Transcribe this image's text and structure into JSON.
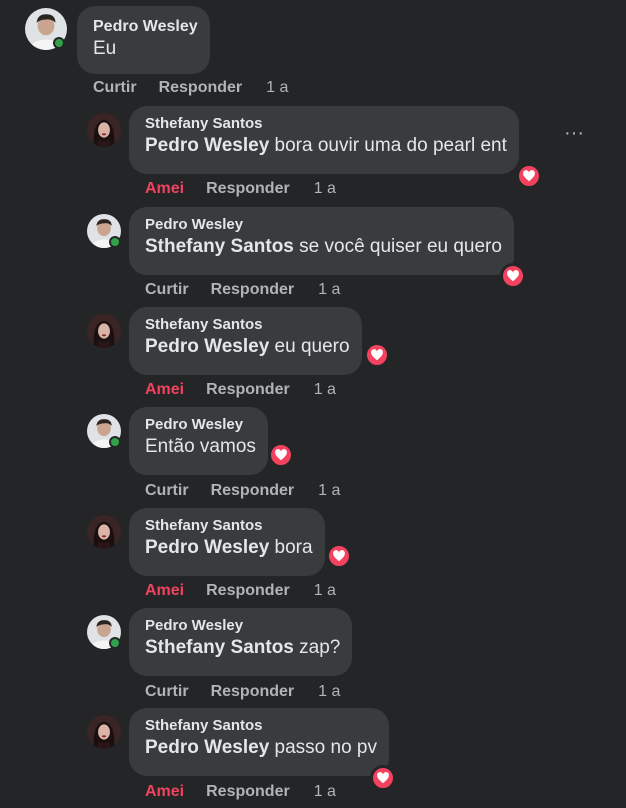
{
  "comment": {
    "author": "Pedro Wesley",
    "text": "Eu",
    "actions": {
      "like": "Curtir",
      "reply": "Responder",
      "time": "1 a"
    }
  },
  "replies": [
    {
      "author": "Sthefany Santos",
      "mention": "Pedro Wesley",
      "text": " bora ouvir uma do pearl ent",
      "reaction": "love",
      "like_label": "Amei",
      "reply_label": "Responder",
      "time": "1 a"
    },
    {
      "author": "Pedro Wesley",
      "mention": "Sthefany Santos",
      "text": " se você quiser eu quero",
      "reaction": "love",
      "like_label": "Curtir",
      "reply_label": "Responder",
      "time": "1 a"
    },
    {
      "author": "Sthefany Santos",
      "mention": "Pedro Wesley",
      "text": " eu quero",
      "reaction": "love",
      "like_label": "Amei",
      "reply_label": "Responder",
      "time": "1 a"
    },
    {
      "author": "Pedro Wesley",
      "mention": "",
      "text": "Então vamos",
      "reaction": "love",
      "like_label": "Curtir",
      "reply_label": "Responder",
      "time": "1 a"
    },
    {
      "author": "Sthefany Santos",
      "mention": "Pedro Wesley",
      "text": " bora",
      "reaction": "love",
      "like_label": "Amei",
      "reply_label": "Responder",
      "time": "1 a"
    },
    {
      "author": "Pedro Wesley",
      "mention": "Sthefany Santos",
      "text": " zap?",
      "reaction": "",
      "like_label": "Curtir",
      "reply_label": "Responder",
      "time": "1 a"
    },
    {
      "author": "Sthefany Santos",
      "mention": "Pedro Wesley",
      "text": " passo no pv",
      "reaction": "love",
      "like_label": "Amei",
      "reply_label": "Responder",
      "time": "1 a"
    }
  ],
  "more_options": "···",
  "colors": {
    "background": "#242526",
    "bubble": "#3a3b3c",
    "love": "#f3425f",
    "online": "#31a24c"
  }
}
